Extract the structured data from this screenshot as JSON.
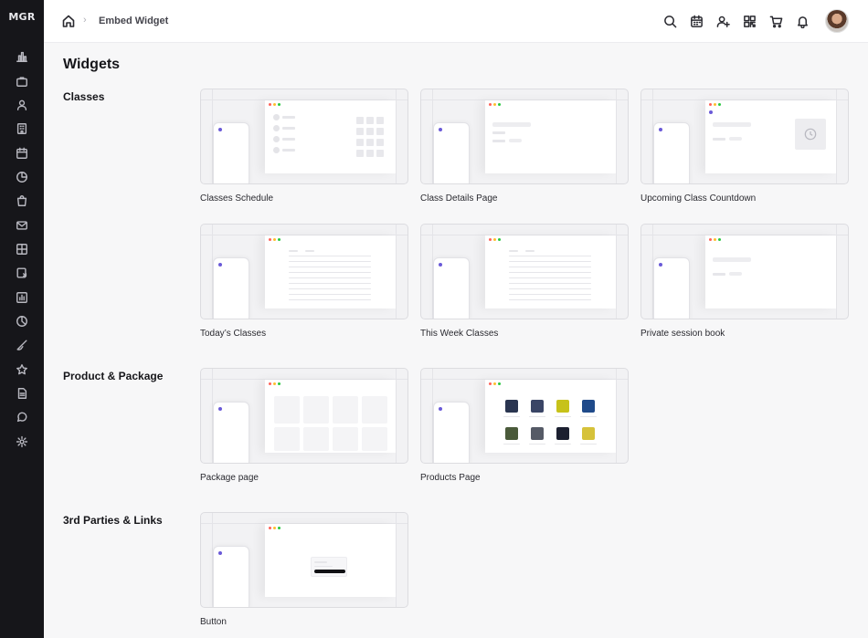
{
  "app": {
    "logo": "MGR"
  },
  "sidebar": {
    "items": [
      {
        "name": "sidebar-item-dashboard",
        "icon": "chart-bar-icon"
      },
      {
        "name": "sidebar-item-briefcase",
        "icon": "briefcase-icon"
      },
      {
        "name": "sidebar-item-users",
        "icon": "user-icon"
      },
      {
        "name": "sidebar-item-building",
        "icon": "building-icon"
      },
      {
        "name": "sidebar-item-calendar",
        "icon": "calendar-icon"
      },
      {
        "name": "sidebar-item-reports",
        "icon": "pie-chart-icon"
      },
      {
        "name": "sidebar-item-shop",
        "icon": "shopping-bag-icon"
      },
      {
        "name": "sidebar-item-messages",
        "icon": "mail-icon"
      },
      {
        "name": "sidebar-item-widgets",
        "icon": "grid-icon"
      },
      {
        "name": "sidebar-item-share",
        "icon": "share-icon"
      },
      {
        "name": "sidebar-item-analytics",
        "icon": "bar-chart-icon"
      },
      {
        "name": "sidebar-item-stats",
        "icon": "pie-icon"
      },
      {
        "name": "sidebar-item-design",
        "icon": "brush-icon"
      },
      {
        "name": "sidebar-item-favorites",
        "icon": "star-icon"
      },
      {
        "name": "sidebar-item-documents",
        "icon": "document-icon"
      },
      {
        "name": "sidebar-item-support",
        "icon": "chat-icon"
      },
      {
        "name": "sidebar-item-settings",
        "icon": "gear-icon"
      }
    ]
  },
  "header": {
    "breadcrumb_separator": "›",
    "breadcrumb_current": "Embed Widget",
    "icons": [
      "search-icon",
      "calendar-icon",
      "add-user-icon",
      "qr-code-icon",
      "cart-icon",
      "bell-icon"
    ]
  },
  "main": {
    "title": "Widgets",
    "sections": [
      {
        "title": "Classes",
        "cards": [
          {
            "label": "Classes Schedule"
          },
          {
            "label": "Class Details Page"
          },
          {
            "label": "Upcoming Class Countdown"
          },
          {
            "label": "Today’s Classes"
          },
          {
            "label": "This Week Classes"
          },
          {
            "label": "Private session book"
          }
        ]
      },
      {
        "title": "Product & Package",
        "cards": [
          {
            "label": "Package page"
          },
          {
            "label": "Products Page"
          }
        ]
      },
      {
        "title": "3rd Parties & Links",
        "cards": [
          {
            "label": "Button"
          }
        ]
      }
    ]
  },
  "colors": {
    "sidebar_bg": "#16161a",
    "accent": "#6a5ad8",
    "page_bg": "#f7f7f8"
  }
}
